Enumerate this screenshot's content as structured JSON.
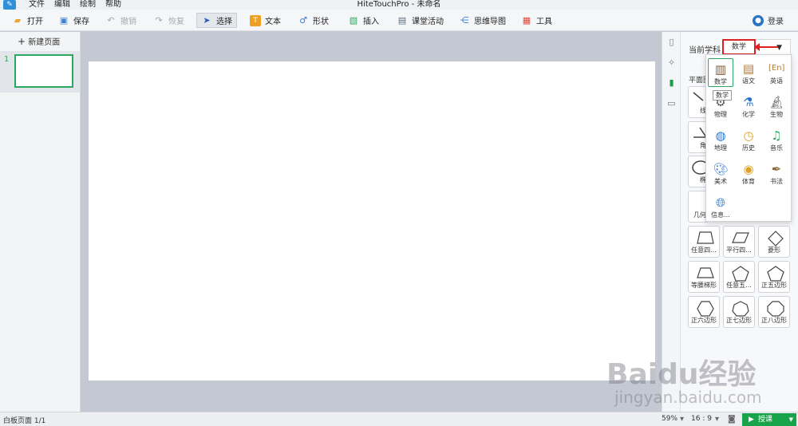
{
  "app": {
    "window_title": "HiteTouchPro - 未命名",
    "menus": [
      "文件",
      "编辑",
      "绘制",
      "帮助"
    ]
  },
  "toolbar": {
    "open": "打开",
    "save": "保存",
    "undo": "撤销",
    "redo": "恢复",
    "select": "选择",
    "text": "文本",
    "shape": "形状",
    "insert": "插入",
    "class_activity": "课堂活动",
    "mind_map": "思维导图",
    "tools": "工具",
    "login": "登录"
  },
  "left_panel": {
    "new_page": "新建页面",
    "pages": [
      {
        "number": "1"
      }
    ]
  },
  "right_panel": {
    "subject_label": "当前学科",
    "current_subject": "数学",
    "section_label": "平面图",
    "partial_labels": [
      "线",
      "角",
      "椭",
      "几何"
    ],
    "shapes": [
      {
        "label": "任意四..."
      },
      {
        "label": "平行四..."
      },
      {
        "label": "菱形"
      },
      {
        "label": "等腰梯形"
      },
      {
        "label": "任意五..."
      },
      {
        "label": "正五边形"
      },
      {
        "label": "正六边形"
      },
      {
        "label": "正七边形"
      },
      {
        "label": "正八边形"
      }
    ]
  },
  "subject_menu": {
    "tooltip": "数学",
    "items": [
      {
        "label": "数学",
        "icon": "abacus-icon"
      },
      {
        "label": "语文",
        "icon": "chinese-book-icon"
      },
      {
        "label": "英语",
        "icon": "english-icon"
      },
      {
        "label": "物理",
        "icon": "physics-icon"
      },
      {
        "label": "化学",
        "icon": "flask-icon"
      },
      {
        "label": "生物",
        "icon": "microscope-icon"
      },
      {
        "label": "地理",
        "icon": "globe-icon"
      },
      {
        "label": "历史",
        "icon": "clock-icon"
      },
      {
        "label": "音乐",
        "icon": "music-icon"
      },
      {
        "label": "美术",
        "icon": "palette-icon"
      },
      {
        "label": "体育",
        "icon": "ball-icon"
      },
      {
        "label": "书法",
        "icon": "brush-icon"
      },
      {
        "label": "信息...",
        "icon": "info-globe-icon"
      }
    ]
  },
  "status": {
    "page_info": "白板页面 1/1",
    "zoom": "59%",
    "ratio": "16 : 9",
    "teach": "授课"
  },
  "watermark": {
    "logo": "Baidu经验",
    "url": "jingyan.baidu.com"
  },
  "colors": {
    "accent_green": "#2aa861",
    "highlight_red": "#e02020"
  }
}
